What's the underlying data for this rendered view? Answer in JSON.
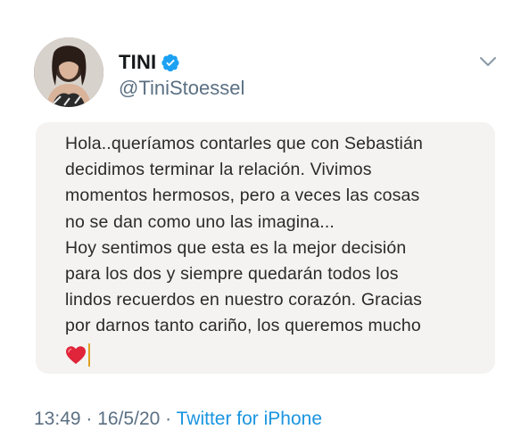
{
  "user": {
    "display_name": "TINI",
    "handle": "@TiniStoessel",
    "verified": true
  },
  "note": {
    "text": "Hola..queríamos contarles que con Sebastián\ndecidimos terminar la relación. Vivimos\nmomentos hermosos, pero a veces las cosas\nno se dan como uno las imagina...\nHoy sentimos que esta es la mejor decisión\npara los dos y siempre quedarán todos los\nlindos recuerdos en nuestro corazón. Gracias\npor darnos tanto cariño, los queremos mucho",
    "emoji": "heart-icon"
  },
  "meta": {
    "time": "13:49",
    "separator1": " · ",
    "date": "16/5/20",
    "separator2": " · ",
    "source": "Twitter for iPhone"
  },
  "colors": {
    "accent": "#1b95e0",
    "verified_badge": "#1da1f2",
    "secondary_text": "#5b7083",
    "note_background": "#f4f3f1",
    "heart": "#e0243a"
  },
  "icons": {
    "verified": "verified-badge-icon",
    "more": "chevron-down-icon",
    "emoji": "heart-icon"
  }
}
